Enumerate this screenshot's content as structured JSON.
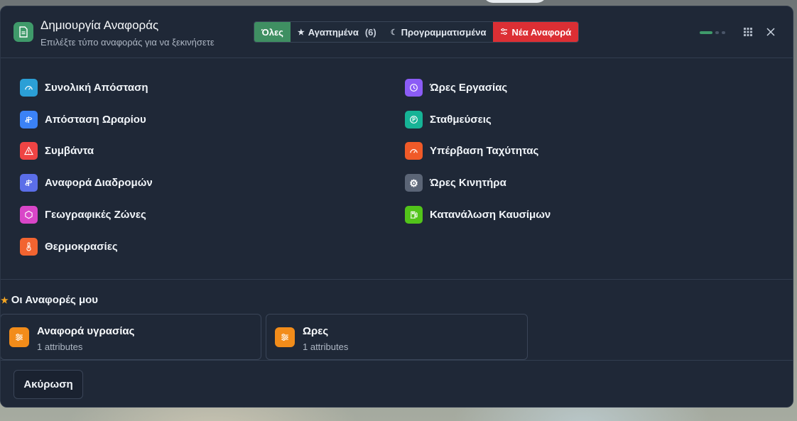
{
  "header": {
    "title": "Δημιουργία Αναφοράς",
    "subtitle": "Επιλέξτε τύπο αναφοράς για να ξεκινήσετε",
    "icon": "document-icon"
  },
  "tabs": [
    {
      "label": "Όλες",
      "active": true
    },
    {
      "label": "Αγαπημένα",
      "count": "(6)",
      "icon": "star-icon"
    },
    {
      "label": "Προγραμματισμένα",
      "icon": "moon-icon"
    },
    {
      "label": "Νέα Αναφορά",
      "icon": "sliders-icon"
    }
  ],
  "reports_left": [
    {
      "label": "Συνολική Απόσταση",
      "icon": "speedometer-icon",
      "color": "#2b9fd6"
    },
    {
      "label": "Απόσταση Ωραρίου",
      "icon": "signpost-icon",
      "color": "#3b82f6"
    },
    {
      "label": "Συμβάντα",
      "icon": "warning-icon",
      "color": "#ef4444"
    },
    {
      "label": "Αναφορά Διαδρομών",
      "icon": "signpost-icon",
      "color": "#5b6ee8"
    },
    {
      "label": "Γεωγραφικές Ζώνες",
      "icon": "hexagon-icon",
      "color": "#d946c8"
    },
    {
      "label": "Θερμοκρασίες",
      "icon": "thermometer-icon",
      "color": "#f26430"
    }
  ],
  "reports_right": [
    {
      "label": "Ώρες Εργασίας",
      "icon": "clock-icon",
      "color": "#8b5cf6"
    },
    {
      "label": "Σταθμεύσεις",
      "icon": "parking-icon",
      "color": "#16b396"
    },
    {
      "label": "Υπέρβαση Ταχύτητας",
      "icon": "speedometer-icon",
      "color": "#f05a28"
    },
    {
      "label": "Ώρες Κινητήρα",
      "icon": "gear-icon",
      "color": "#5b6576"
    },
    {
      "label": "Κατανάλωση Καυσίμων",
      "icon": "fuel-icon",
      "color": "#52c41a"
    }
  ],
  "my_reports": {
    "title": "Οι Αναφορές μου",
    "items": [
      {
        "name": "Αναφορά υγρασίας",
        "attributes": "1 attributes"
      },
      {
        "name": "Ωρες",
        "attributes": "1 attributes"
      }
    ]
  },
  "footer": {
    "cancel_label": "Ακύρωση"
  }
}
